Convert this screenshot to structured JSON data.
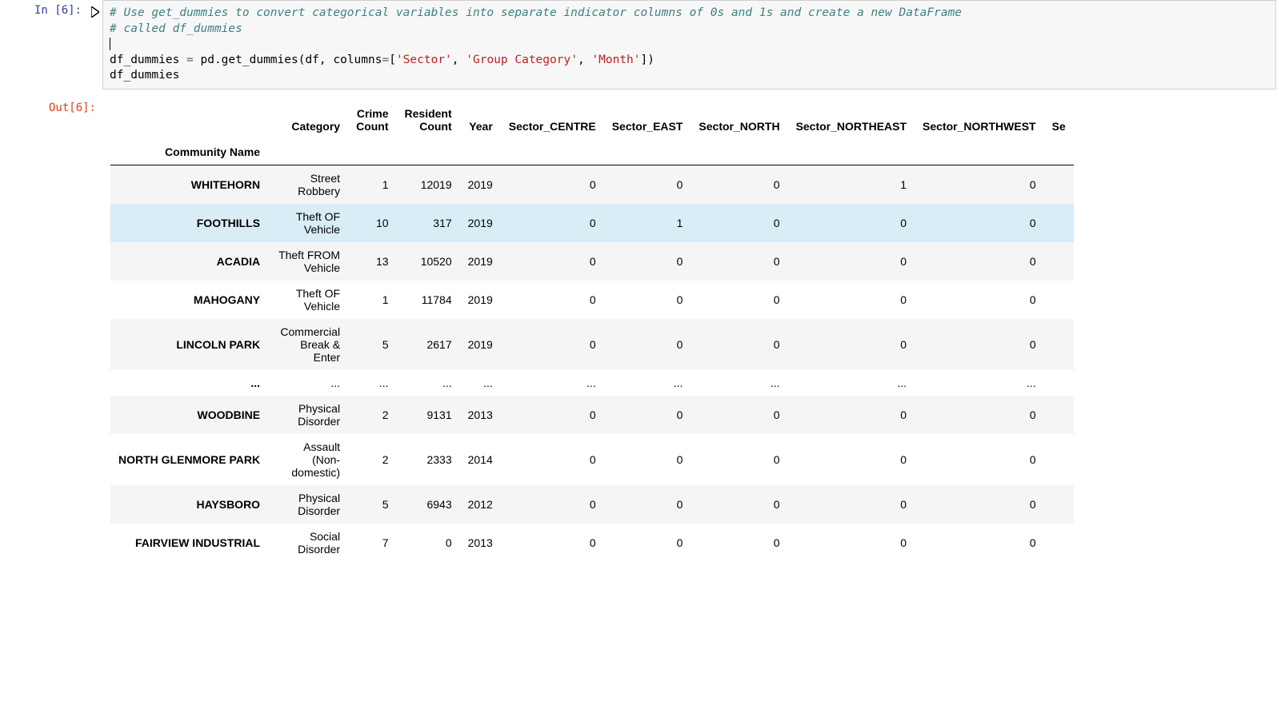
{
  "input_prompt": "In [6]:",
  "output_prompt": "Out[6]:",
  "code": {
    "comment1": "# Use get_dummies to convert categorical variables into separate indicator columns of 0s and 1s and create a new DataFrame",
    "comment2": "# called df_dummies",
    "line1_var": "df_dummies ",
    "line1_eq": "=",
    "line1_call": " pd.get_dummies(df, columns",
    "line1_eq2": "=",
    "line1_br": "[",
    "line1_s1": "'Sector'",
    "line1_c1": ", ",
    "line1_s2": "'Group Category'",
    "line1_c2": ", ",
    "line1_s3": "'Month'",
    "line1_br2": "])",
    "line2": "df_dummies"
  },
  "table": {
    "index_name": "Community Name",
    "columns": [
      "Category",
      "Crime Count",
      "Resident Count",
      "Year",
      "Sector_CENTRE",
      "Sector_EAST",
      "Sector_NORTH",
      "Sector_NORTHEAST",
      "Sector_NORTHWEST",
      "Se"
    ],
    "rows": [
      {
        "idx": "WHITEHORN",
        "cells": [
          "Street Robbery",
          "1",
          "12019",
          "2019",
          "0",
          "0",
          "0",
          "1",
          "0",
          ""
        ]
      },
      {
        "idx": "FOOTHILLS",
        "cells": [
          "Theft OF Vehicle",
          "10",
          "317",
          "2019",
          "0",
          "1",
          "0",
          "0",
          "0",
          ""
        ],
        "highlight": true
      },
      {
        "idx": "ACADIA",
        "cells": [
          "Theft FROM Vehicle",
          "13",
          "10520",
          "2019",
          "0",
          "0",
          "0",
          "0",
          "0",
          ""
        ]
      },
      {
        "idx": "MAHOGANY",
        "cells": [
          "Theft OF Vehicle",
          "1",
          "11784",
          "2019",
          "0",
          "0",
          "0",
          "0",
          "0",
          ""
        ]
      },
      {
        "idx": "LINCOLN PARK",
        "cells": [
          "Commercial Break & Enter",
          "5",
          "2617",
          "2019",
          "0",
          "0",
          "0",
          "0",
          "0",
          ""
        ]
      },
      {
        "idx": "...",
        "cells": [
          "...",
          "...",
          "...",
          "...",
          "...",
          "...",
          "...",
          "...",
          "...",
          ""
        ]
      },
      {
        "idx": "WOODBINE",
        "cells": [
          "Physical Disorder",
          "2",
          "9131",
          "2013",
          "0",
          "0",
          "0",
          "0",
          "0",
          ""
        ]
      },
      {
        "idx": "NORTH GLENMORE PARK",
        "cells": [
          "Assault (Non-domestic)",
          "2",
          "2333",
          "2014",
          "0",
          "0",
          "0",
          "0",
          "0",
          ""
        ]
      },
      {
        "idx": "HAYSBORO",
        "cells": [
          "Physical Disorder",
          "5",
          "6943",
          "2012",
          "0",
          "0",
          "0",
          "0",
          "0",
          ""
        ]
      },
      {
        "idx": "FAIRVIEW INDUSTRIAL",
        "cells": [
          "Social Disorder",
          "7",
          "0",
          "2013",
          "0",
          "0",
          "0",
          "0",
          "0",
          ""
        ]
      }
    ]
  }
}
